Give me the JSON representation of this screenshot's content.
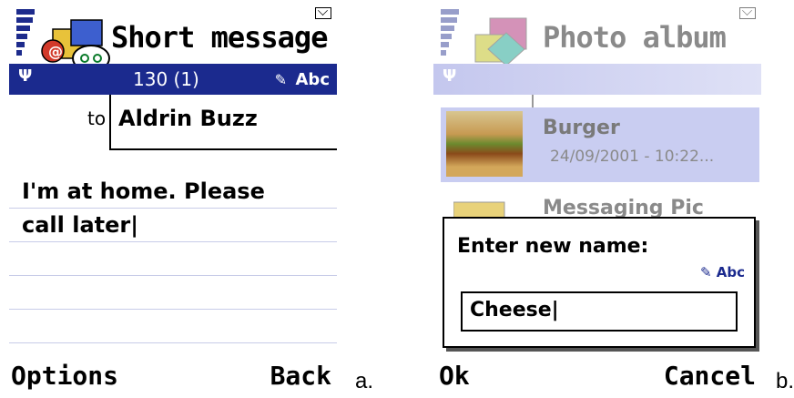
{
  "screen_a": {
    "title": "Short message",
    "char_counter": "130 (1)",
    "input_mode": "Abc",
    "to_label": "to",
    "recipient": "Aldrin Buzz",
    "message_line1": "I'm at home. Please",
    "message_line2": "call later|",
    "softkey_left": "Options",
    "softkey_right": "Back",
    "caption": "a."
  },
  "screen_b": {
    "title": "Photo album",
    "item1_name": "Burger",
    "item1_date": "24/09/2001 - 10:22...",
    "item2_name": "Messaging Pic",
    "dialog_prompt": "Enter new name:",
    "input_mode": "Abc",
    "input_value": "Cheese|",
    "softkey_left": "Ok",
    "softkey_right": "Cancel",
    "caption": "b."
  },
  "colors": {
    "status_blue": "#1b2a8e",
    "selected_row": "#c9cdf1"
  }
}
